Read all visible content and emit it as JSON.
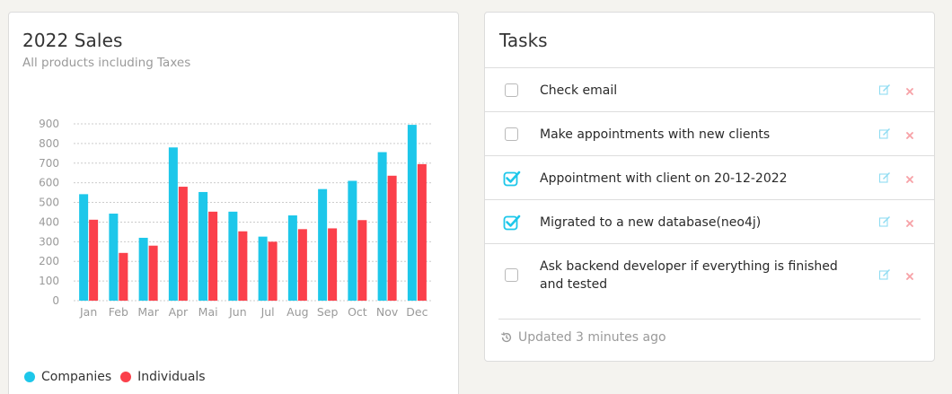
{
  "sales_card": {
    "title": "2022 Sales",
    "subtitle": "All products including Taxes"
  },
  "chart_data": {
    "type": "bar",
    "title": "2022 Sales",
    "subtitle": "All products including Taxes",
    "categories": [
      "Jan",
      "Feb",
      "Mar",
      "Apr",
      "Mai",
      "Jun",
      "Jul",
      "Aug",
      "Sep",
      "Oct",
      "Nov",
      "Dec"
    ],
    "series": [
      {
        "name": "Companies",
        "color": "#1dc7ea",
        "values": [
          542,
          443,
          320,
          780,
          553,
          453,
          326,
          434,
          568,
          610,
          756,
          895
        ]
      },
      {
        "name": "Individuals",
        "color": "#fb404b",
        "values": [
          412,
          243,
          280,
          580,
          453,
          353,
          300,
          364,
          368,
          410,
          636,
          695
        ]
      }
    ],
    "yticks": [
      0,
      100,
      200,
      300,
      400,
      500,
      600,
      700,
      800,
      900
    ],
    "ylim": [
      0,
      900
    ],
    "grid": true,
    "legend_position": "bottom-left"
  },
  "legend": [
    {
      "label": "Companies",
      "color": "#1dc7ea"
    },
    {
      "label": "Individuals",
      "color": "#fb404b"
    }
  ],
  "tasks_card": {
    "title": "Tasks",
    "footer": "Updated 3 minutes ago",
    "footer_icon": "history-icon",
    "edit_icon": "edit-icon",
    "delete_icon": "close-icon",
    "items": [
      {
        "text": "Check email",
        "checked": false
      },
      {
        "text": "Make appointments with new clients",
        "checked": false
      },
      {
        "text": "Appointment with client on 20-12-2022",
        "checked": true
      },
      {
        "text": "Migrated to a new database(neo4j)",
        "checked": true
      },
      {
        "text": "Ask backend developer if everything is finished and tested",
        "checked": false
      }
    ]
  }
}
